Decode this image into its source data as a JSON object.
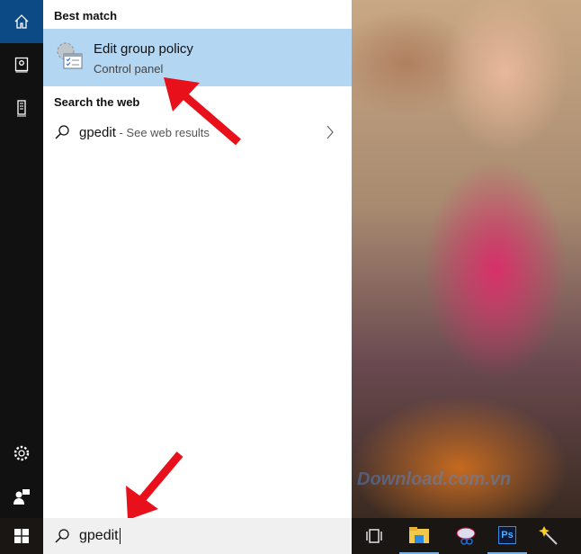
{
  "rail": {
    "items": [
      "home-icon",
      "notebook-icon",
      "tower-icon",
      "gear-icon",
      "feedback-icon"
    ]
  },
  "panel": {
    "best_match_header": "Best match",
    "best_match": {
      "title": "Edit group policy",
      "subtitle": "Control panel",
      "icon": "group-policy-icon"
    },
    "web_header": "Search the web",
    "web_result": {
      "query": "gpedit",
      "suffix": " - See web results"
    }
  },
  "search": {
    "value": "gpedit"
  },
  "watermark": "Download.com.vn",
  "taskbar": {
    "items": [
      "task-view-icon",
      "file-explorer-icon",
      "snipping-tool-icon",
      "photoshop-icon",
      "magic-wand-app-icon"
    ],
    "photoshop_label": "Ps"
  },
  "colors": {
    "accent": "#0b4a84",
    "selection": "#b3d6f2",
    "annotation_arrow": "#e8101a"
  }
}
